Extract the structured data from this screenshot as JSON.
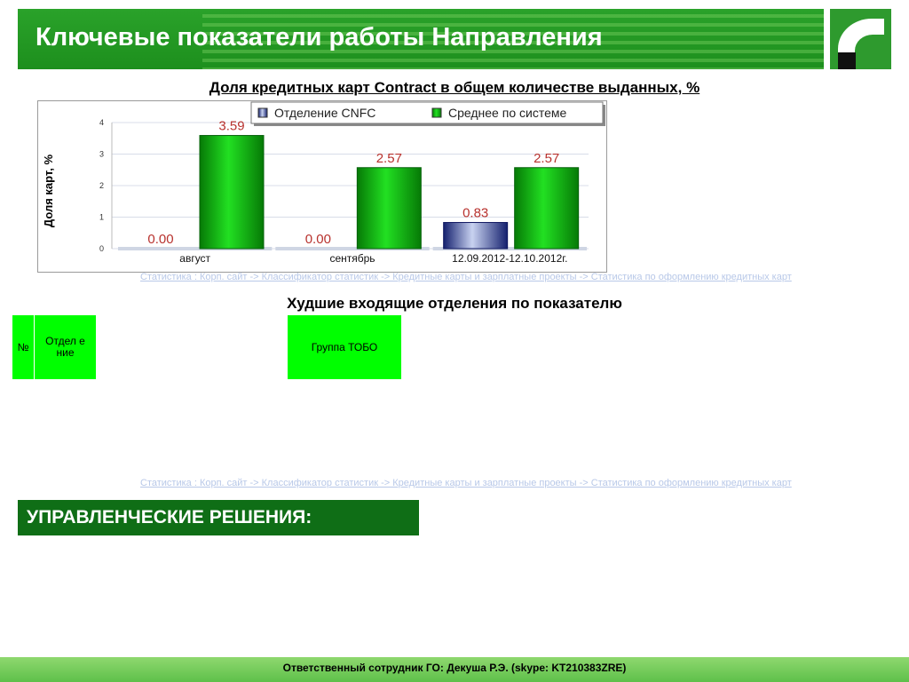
{
  "header": {
    "title": "Ключевые показатели работы Направления"
  },
  "chart_data": {
    "type": "bar",
    "title": "Доля кредитных карт Contract в общем количестве выданных, %",
    "ylabel": "Доля карт, %",
    "xlabel": "",
    "ylim": [
      0,
      4
    ],
    "yticks": [
      "0",
      "1",
      "2",
      "3",
      "4"
    ],
    "categories": [
      "август",
      "сентябрь",
      "12.09.2012-12.10.2012г."
    ],
    "series": [
      {
        "name": "Отделение CNFC",
        "values": [
          0,
          0,
          0.83
        ],
        "labels": [
          "0.00",
          "0.00",
          "0.83"
        ],
        "color": "#1a2a8a"
      },
      {
        "name": "Среднее по системе",
        "values": [
          3.59,
          2.57,
          2.57
        ],
        "labels": [
          "3.59",
          "2.57",
          "2.57"
        ],
        "color": "#0a9a0a"
      }
    ],
    "legend": "top-right",
    "grid": true
  },
  "links": {
    "source1": "Статистика : Корп. сайт -> Классификатор статистик -> Кредитные карты и зарплатные проекты -> Статистика по оформлению кредитных карт",
    "source2": "Статистика : Корп. сайт -> Классификатор статистик -> Кредитные карты и зарплатные проекты -> Статистика по оформлению кредитных карт"
  },
  "worst": {
    "title": "Худшие входящие отделения по показателю",
    "col_num": "№",
    "col_dept": "Отдел ение",
    "col_group": "Группа ТОБО"
  },
  "decisions": {
    "title": "УПРАВЛЕНЧЕСКИЕ РЕШЕНИЯ:"
  },
  "footer": {
    "text": "Ответственный сотрудник ГО: Декуша Р.Э. (skype: KT210383ZRE)"
  }
}
